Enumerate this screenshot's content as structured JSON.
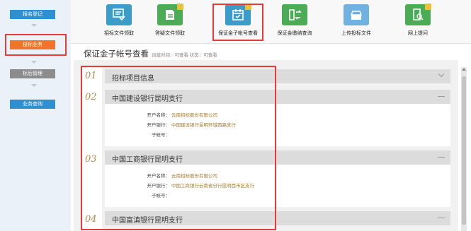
{
  "sidebar": {
    "items": [
      {
        "label": "报名登记"
      },
      {
        "label": "投标业务"
      },
      {
        "label": "标后管理"
      },
      {
        "label": "业务查询"
      }
    ]
  },
  "toolbar": {
    "items": [
      {
        "label": "招标文件领取",
        "icon": "document-receive-icon"
      },
      {
        "label": "答疑文件领取",
        "icon": "qa-file-icon"
      },
      {
        "label": "保证金子帐号查看",
        "icon": "calendar-check-icon"
      },
      {
        "label": "保证金缴纳查询",
        "icon": "exchange-icon"
      },
      {
        "label": "上传投标文件",
        "icon": "upload-tray-icon"
      },
      {
        "label": "网上提问",
        "icon": "search-doc-icon"
      }
    ]
  },
  "page": {
    "title": "保证金子帐号查看",
    "meta": "创建时间：可查看  状态：可查看"
  },
  "sections": [
    {
      "num": "01",
      "title": "招标项目信息"
    },
    {
      "num": "02",
      "title": "中国建设银行昆明支行",
      "fields": [
        {
          "label": "开户名称：",
          "value": "云南招标股份有限公司"
        },
        {
          "label": "开户银行：",
          "value": "中国建设银行昆明环城西路支行"
        },
        {
          "label": "子帐号：",
          "value": ""
        }
      ]
    },
    {
      "num": "03",
      "title": "中国工商银行昆明支行",
      "fields": [
        {
          "label": "开户名称：",
          "value": "云南招标股份有限公司"
        },
        {
          "label": "开户银行：",
          "value": "中国工商银行云南省分行昆明西市区支行"
        },
        {
          "label": "子帐号：",
          "value": ""
        }
      ]
    },
    {
      "num": "04",
      "title": "中国富滇银行昆明支行"
    }
  ],
  "colors": {
    "sidebar_blue": "#2e8fd1",
    "sidebar_active": "#f2742a",
    "highlight_red": "#e83a3a",
    "value_text": "#a57b2f"
  }
}
